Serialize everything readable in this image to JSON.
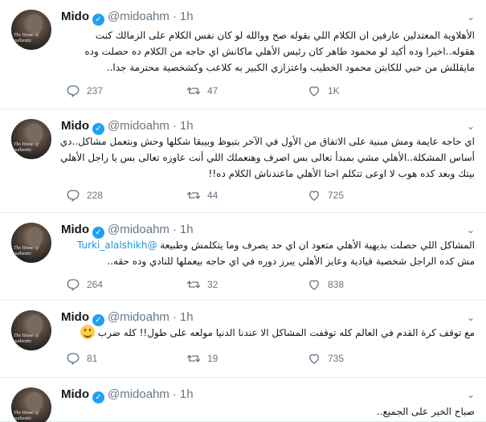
{
  "tweets": [
    {
      "name": "Mido",
      "handle": "@midoahm",
      "dot": "·",
      "time": "1h",
      "avatar_text": "The Home of authentic",
      "text_parts": [
        {
          "t": "الأهلاوية المعتدلين عارفين ان الكلام اللي بقوله صح ووالله لو كان نفس الكلام على الزمالك كنت هقوله..اخيرا وده أكيد لو محمود طاهر كان رئيس الأهلي ماكانش اي حاجه من الكلام ده حصلت وده مايقللش من حبي للكابتن محمود الخطيب واعتزازي الكبير به كلاعب وكشخصية محترمة جدا.."
        }
      ],
      "replies": "237",
      "retweets": "47",
      "likes": "1K"
    },
    {
      "name": "Mido",
      "handle": "@midoahm",
      "dot": "·",
      "time": "1h",
      "avatar_text": "The Home of authentic",
      "text_parts": [
        {
          "t": "اي حاجه عايمة ومش مبنية على الاتفاق من الأول في الآخر بتبوظ وبيبقا شكلها وحش وبتعمل مشاكل..دي أساس المشكلة..الأهلي مشي بمبدأ تعالى بس اصرف وهنعملك اللي أنت عاوزه تعالى بس يا راجل الأهلي بيتك وبعد كده هوب لا اوعى تتكلم احنا الأهلي ماعندناش الكلام ده!!"
        }
      ],
      "replies": "228",
      "retweets": "44",
      "likes": "725"
    },
    {
      "name": "Mido",
      "handle": "@midoahm",
      "dot": "·",
      "time": "1h",
      "avatar_text": "The Home of authentic",
      "text_parts": [
        {
          "t": "المشاكل اللي حصلت بديهية الأهلي متعود ان اي حد يصرف وما يتكلمش وطبيعة "
        },
        {
          "t": "@Turki_alalshikh",
          "mention": true
        },
        {
          "t": " مش كده الراجل شخصية قيادية وعايز الأهلي يبرز دوره في اي حاجه بيعملها للنادي وده حقه.."
        }
      ],
      "replies": "264",
      "retweets": "32",
      "likes": "838"
    },
    {
      "name": "Mido",
      "handle": "@midoahm",
      "dot": "·",
      "time": "1h",
      "avatar_text": "The Home of authentic",
      "text_parts": [
        {
          "t": "مع توقف كرة القدم في العالم كله توقفت المشاكل الا عندنا الدنيا مولعه على طول!! كله ضرب "
        },
        {
          "emoji": "grinning-face"
        }
      ],
      "replies": "81",
      "retweets": "19",
      "likes": "735"
    },
    {
      "name": "Mido",
      "handle": "@midoahm",
      "dot": "·",
      "time": "1h",
      "avatar_text": "The Home of authentic",
      "text_parts": [
        {
          "t": "صباح الخير على الجميع.."
        }
      ],
      "replies": "",
      "retweets": "",
      "likes": ""
    }
  ],
  "icons": {
    "reply": "reply-icon",
    "retweet": "retweet-icon",
    "like": "like-icon",
    "menu": "chevron-down-icon",
    "verified": "verified-badge-icon"
  },
  "colors": {
    "accent": "#1da1f2",
    "mention": "#1b95e0",
    "muted": "#657786",
    "text": "#14171a"
  }
}
